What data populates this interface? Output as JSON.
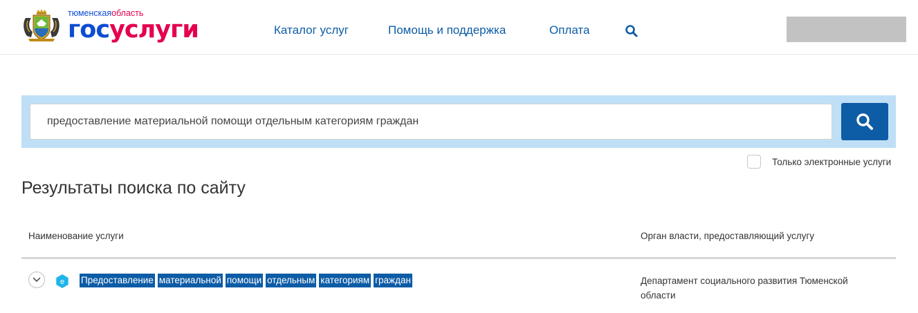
{
  "header": {
    "logo": {
      "region_part1": "тюменская",
      "region_part2": "область",
      "brand_part1": "гос",
      "brand_part2": "услуги",
      "emblem_icon": "tyumen-coat-of-arms-icon"
    },
    "nav": [
      {
        "label": "Каталог услуг"
      },
      {
        "label": "Помощь и поддержка"
      },
      {
        "label": "Оплата"
      }
    ],
    "search_icon": "search-icon"
  },
  "search": {
    "value": "предоставление материальной помощи отдельным категориям граждан",
    "button_icon": "search-icon"
  },
  "filters": {
    "only_electronic_label": "Только электронные услуги",
    "only_electronic_checked": false
  },
  "results": {
    "title": "Результаты поиска по сайту",
    "columns": {
      "name": "Наименование услуги",
      "org": "Орган власти, предоставляющий услугу"
    },
    "rows": [
      {
        "badge": "е",
        "name_words": [
          "Предоставление",
          "материальной",
          "помощи",
          "отдельным",
          "категориям",
          "граждан"
        ],
        "org": "Департамент социального развития Тюменской области"
      }
    ]
  },
  "colors": {
    "primary_blue": "#0d5ca6",
    "brand_blue": "#0d4cd3",
    "brand_red": "#e4004e",
    "search_panel_bg": "#bfdff6",
    "badge_cyan": "#1fb5ea"
  }
}
